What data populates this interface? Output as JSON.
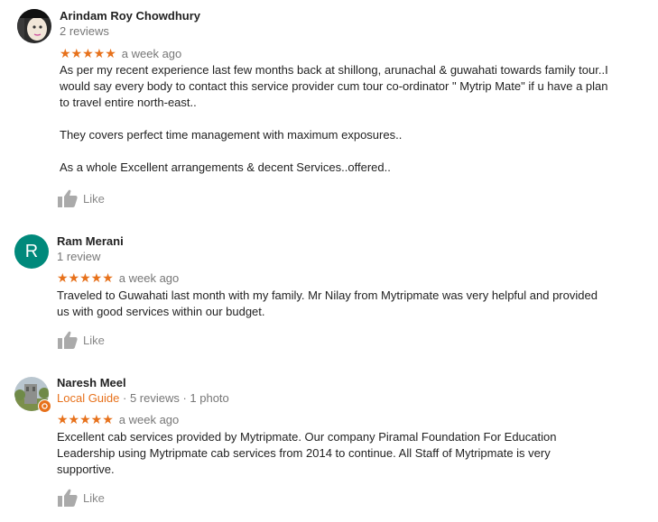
{
  "reviews": [
    {
      "name": "Arindam Roy Chowdhury",
      "meta": "2 reviews",
      "stars": "★★★★★",
      "rating": 5,
      "date": "a week ago",
      "paragraphs": [
        "As per my recent experience last  few months back at shillong,  arunachal & guwahati towards family tour..I would say every body to contact this service provider cum tour co-ordinator \" Mytrip Mate\" if u have a plan to travel entire north-east..",
        "They covers perfect time management with maximum exposures..",
        "As a whole Excellent arrangements & decent Services..offered.."
      ],
      "like_label": "Like"
    },
    {
      "name": "Ram Merani",
      "avatar_letter": "R",
      "meta": "1 review",
      "stars": "★★★★★",
      "rating": 5,
      "date": "a week ago",
      "paragraphs": [
        "Traveled to Guwahati last month with my family. Mr Nilay from Mytripmate was very helpful and provided us with good services within our budget."
      ],
      "like_label": "Like"
    },
    {
      "name": "Naresh Meel",
      "guide": "Local Guide",
      "meta": " · 5 reviews · 1 photo",
      "stars": "★★★★★",
      "rating": 5,
      "date": "a week ago",
      "paragraphs": [
        "Excellent cab services provided by Mytripmate. Our company Piramal Foundation For Education Leadership using Mytripmate cab services from 2014 to continue. All Staff of Mytripmate is very supportive."
      ],
      "like_label": "Like"
    }
  ],
  "colors": {
    "star": "#e7711b",
    "avatar_r": "#00897b",
    "meta": "#777777"
  }
}
